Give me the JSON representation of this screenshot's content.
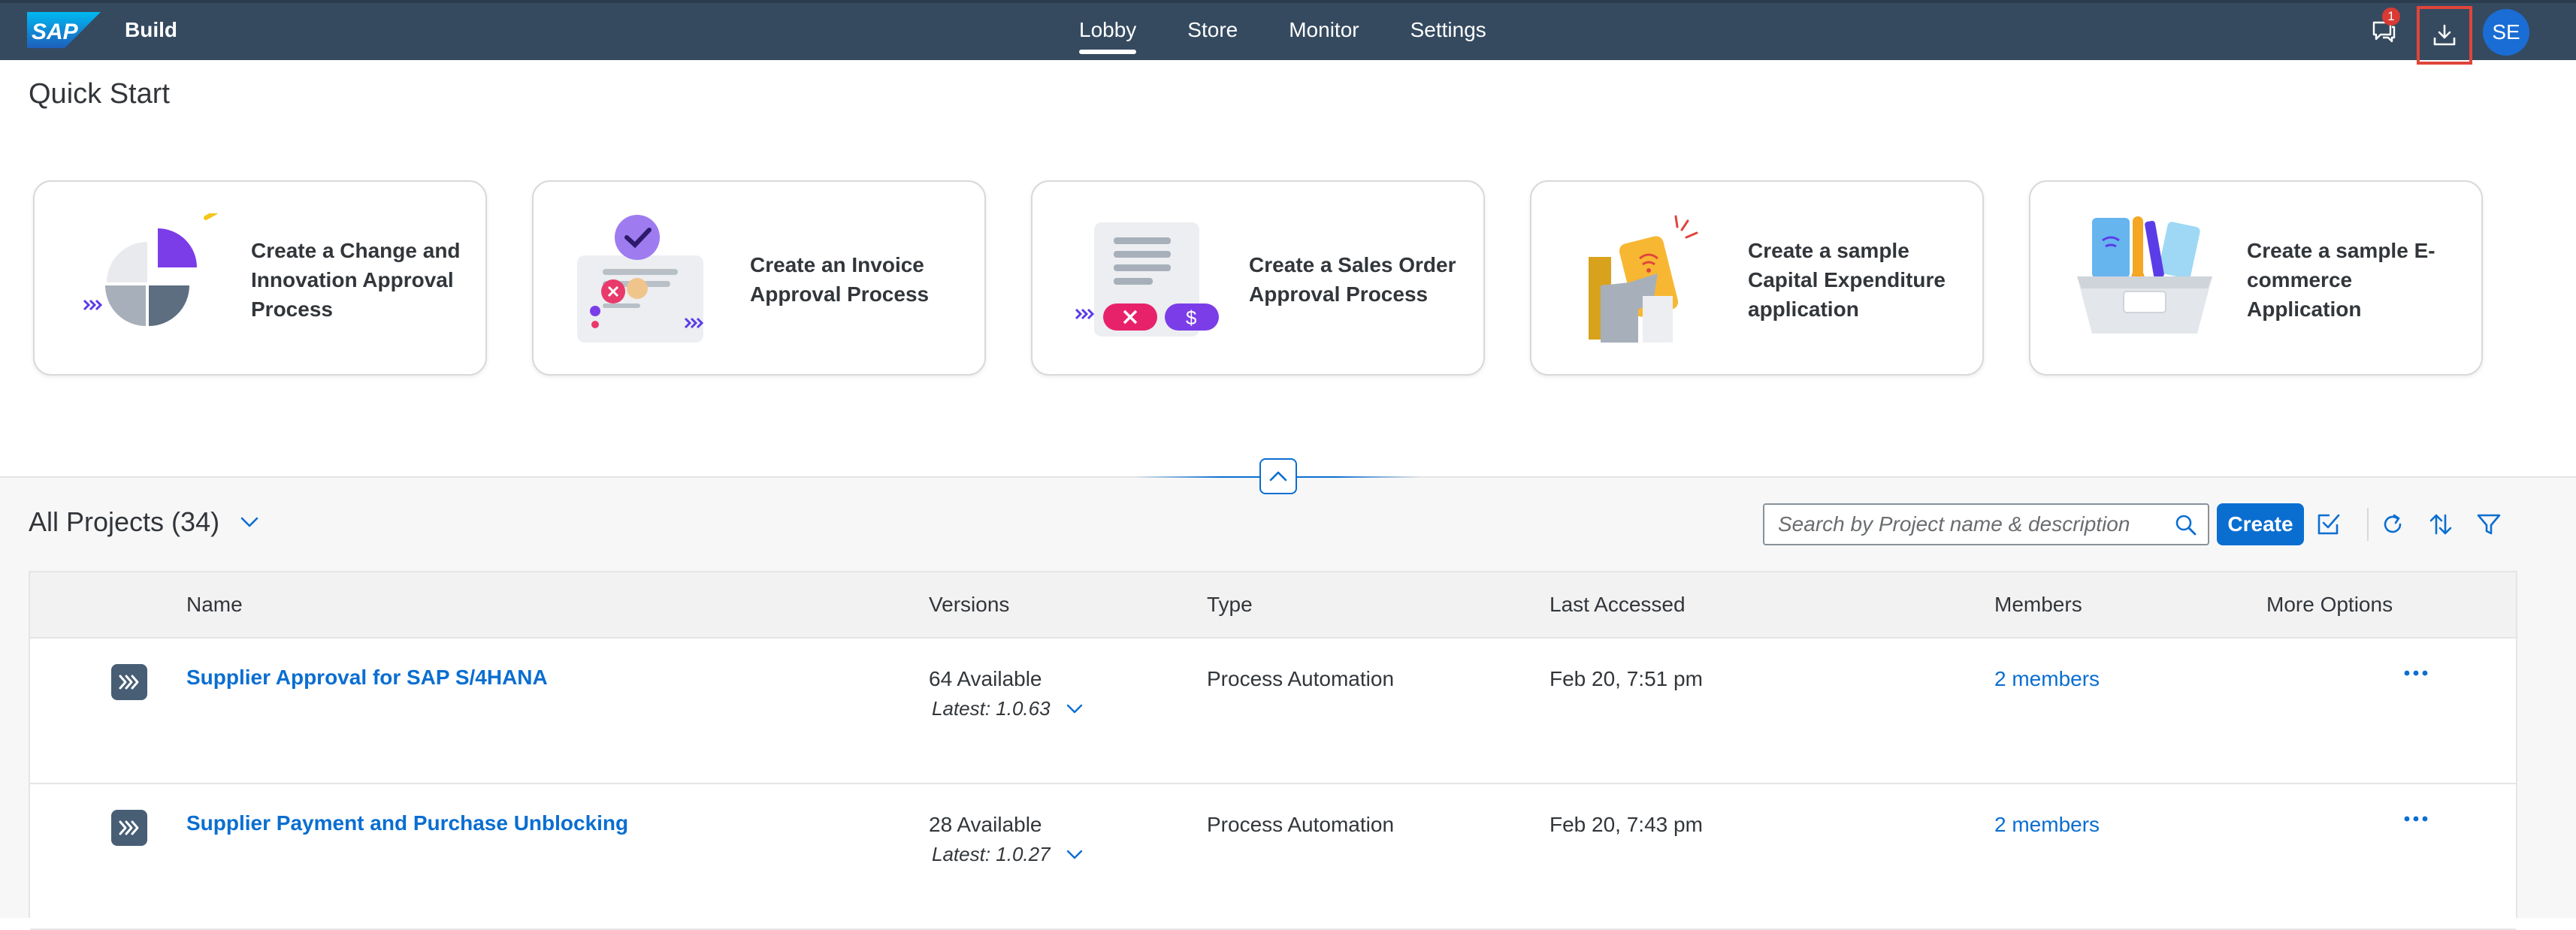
{
  "shell": {
    "logo_text": "SAP",
    "product": "Build",
    "nav": [
      "Lobby",
      "Store",
      "Monitor",
      "Settings"
    ],
    "active_nav": "Lobby",
    "notification_count": "1",
    "user_initials": "SE"
  },
  "quick_start": {
    "title": "Quick Start",
    "cards": [
      {
        "label": "Create a Change and Innovation Approval Process",
        "icon": "pie-chart-illustration"
      },
      {
        "label": "Create an Invoice Approval Process",
        "icon": "invoice-illustration"
      },
      {
        "label": "Create a Sales Order Approval Process",
        "icon": "sales-order-illustration"
      },
      {
        "label": "Create a sample Capital Expenditure application",
        "icon": "phone-wifi-illustration"
      },
      {
        "label": "Create a sample E-commerce Application",
        "icon": "shopping-basket-illustration"
      }
    ]
  },
  "projects": {
    "title": "All Projects (34)",
    "search_placeholder": "Search by Project name & description",
    "create_label": "Create",
    "columns": [
      "Name",
      "Versions",
      "Type",
      "Last Accessed",
      "Members",
      "More Options"
    ],
    "rows": [
      {
        "name": "Supplier Approval for SAP S/4HANA",
        "versions": "64 Available",
        "latest": "Latest: 1.0.63",
        "type": "Process Automation",
        "last_accessed": "Feb 20, 7:51 pm",
        "members": "2 members"
      },
      {
        "name": "Supplier Payment and Purchase Unblocking",
        "versions": "28 Available",
        "latest": "Latest: 1.0.27",
        "type": "Process Automation",
        "last_accessed": "Feb 20, 7:43 pm",
        "members": "2 members"
      }
    ]
  },
  "colors": {
    "shell_bg": "#354a5f",
    "brand_blue": "#0a6ed1",
    "highlight_red": "#e0453b"
  }
}
